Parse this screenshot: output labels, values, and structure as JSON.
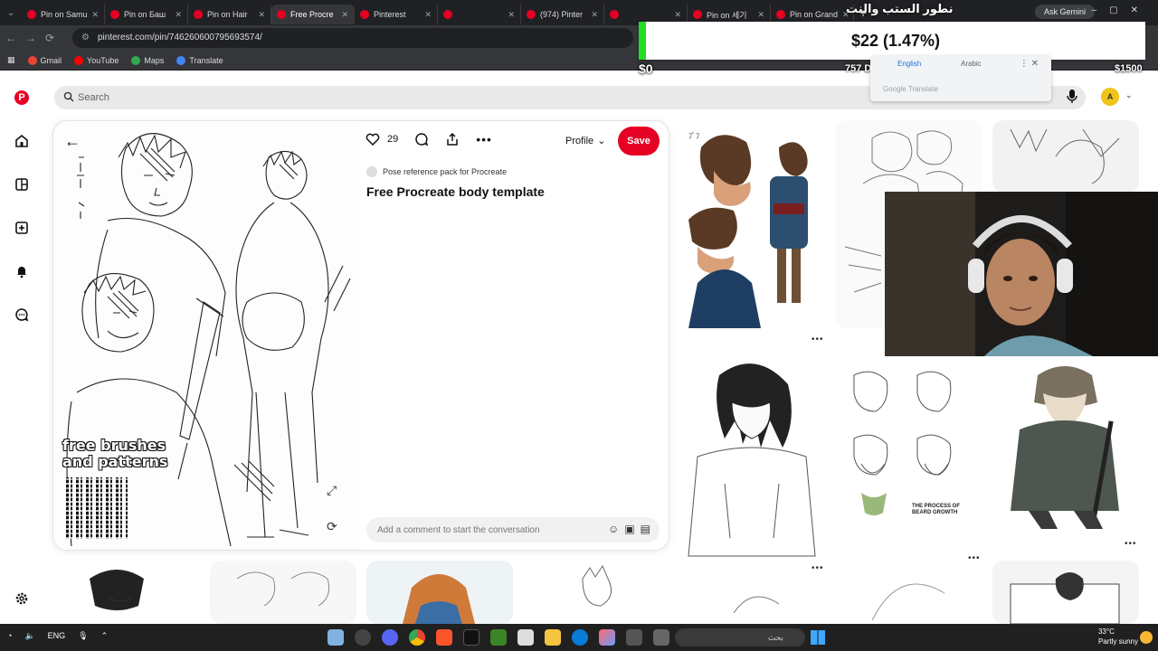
{
  "browser": {
    "tabs": [
      {
        "label": "Pin on Samu"
      },
      {
        "label": "Pin on Баш"
      },
      {
        "label": "Pin on Hair"
      },
      {
        "label": "Free Procre",
        "active": true
      },
      {
        "label": "Pinterest"
      },
      {
        "label": ""
      },
      {
        "label": "(974) Pinter"
      },
      {
        "label": ""
      },
      {
        "label": "Pin on 세기"
      },
      {
        "label": "Pin on Grand"
      }
    ],
    "ask_gemini": "Ask Gemini",
    "url": "pinterest.com/pin/746260600795693574/",
    "bookmarks": [
      {
        "label": "Gmail",
        "color": "#ea4335"
      },
      {
        "label": "YouTube",
        "color": "#ff0000"
      },
      {
        "label": "Maps",
        "color": "#34a853"
      },
      {
        "label": "Translate",
        "color": "#4285f4"
      }
    ]
  },
  "stream_overlay": {
    "price": "$22 (1.47%)",
    "progress_start": "$0",
    "days_to_go": "757 DAYS TO GO",
    "progress_end": "$1500",
    "progress_fraction": 0.0147,
    "headline": "نطور الستب والنت"
  },
  "translate_popup": {
    "source": "English",
    "target": "Arabic",
    "brand": "Google Translate"
  },
  "search": {
    "placeholder": "Search"
  },
  "account": {
    "initial": "A"
  },
  "pin": {
    "like_count": "29",
    "profile_label": "Profile",
    "save_label": "Save",
    "board_name": "Pose reference pack for Procreate",
    "title": "Free Procreate body template",
    "image_caption_line1": "free brushes",
    "image_caption_line2": "and patterns",
    "comment_placeholder": "Add a comment to start the conversation"
  },
  "feed": {
    "beard_sheet_text": "THE PROCESS OF BEARD GROWTH"
  },
  "taskbar": {
    "lang": "ENG",
    "search_label": "بحث",
    "temperature": "33°C",
    "weather": "Partly sunny"
  },
  "colors": {
    "brand_red": "#e60023",
    "progress_green": "#22dd22"
  }
}
